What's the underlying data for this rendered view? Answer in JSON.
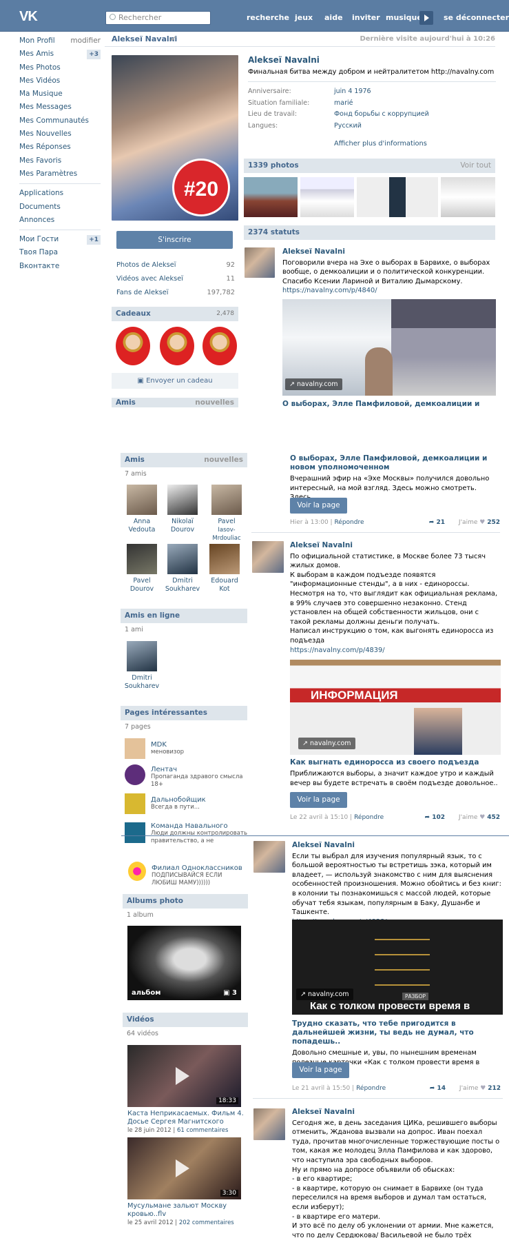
{
  "header": {
    "logo": "VK",
    "search_placeholder": "Rechercher",
    "nav": [
      "recherche",
      "jeux",
      "aide",
      "inviter",
      "musique",
      "se déconnecter"
    ]
  },
  "menu": {
    "items": [
      "Mon Profil",
      "Mes Amis",
      "Mes Photos",
      "Mes Vidéos",
      "Ma Musique",
      "Mes Messages",
      "Mes Communautés",
      "Mes Nouvelles",
      "Mes Réponses",
      "Mes Favoris",
      "Mes Paramètres"
    ],
    "edit": "modifier",
    "friends_badge": "+3",
    "extra": [
      "Applications",
      "Documents",
      "Annonces"
    ],
    "guests": [
      "Мои Гости",
      "Твоя Пара",
      "Вконтакте"
    ],
    "guests_badge": "+1"
  },
  "profile": {
    "name": "Alekseï Navalni",
    "last_visit": "Dernière visite aujourd'hui à 10:26",
    "status": "Финальная битва между добром и нейтралитетом http://navalny.com",
    "avatar_badge": "#20",
    "info": [
      {
        "label": "Anniversaire:",
        "value": "juin 4 1976"
      },
      {
        "label": "Situation familiale:",
        "value": "marié"
      },
      {
        "label": "Lieu de travail:",
        "value": "Фонд борьбы с коррупцией"
      },
      {
        "label": "Langues:",
        "value": "Русский"
      }
    ],
    "more_info": "Afficher plus d'informations",
    "subscribe": "S'inscrire",
    "counters": [
      {
        "label": "Photos de Alekseï",
        "value": "92"
      },
      {
        "label": "Vidéos avec Alekseï",
        "value": "11"
      },
      {
        "label": "Fans de Alekseï",
        "value": "197,782"
      }
    ]
  },
  "gifts": {
    "title": "Cadeaux",
    "count": "2,478",
    "send": "Envoyer un cadeau"
  },
  "photos": {
    "title": "1339 photos",
    "see_all": "Voir tout"
  },
  "statuses": {
    "title": "2374 statuts"
  },
  "friends": {
    "title": "Amis",
    "new": "nouvelles",
    "count": "7 amis",
    "list": [
      {
        "first": "Anna",
        "last": "Vedouta"
      },
      {
        "first": "Nikolaï",
        "last": "Dourov"
      },
      {
        "first": "Pavel",
        "last": "Iasov-Mrdouliac"
      },
      {
        "first": "Pavel",
        "last": "Dourov"
      },
      {
        "first": "Dmitri",
        "last": "Soukharev"
      },
      {
        "first": "Edouard",
        "last": "Kot"
      }
    ]
  },
  "online": {
    "title": "Amis en ligne",
    "count": "1 ami",
    "first": "Dmitri",
    "last": "Soukharev"
  },
  "pages": {
    "title": "Pages intéressantes",
    "count": "7 pages",
    "list": [
      {
        "name": "MDK",
        "desc": "меновизор"
      },
      {
        "name": "Лентач",
        "desc": "Пропаганда здравого смысла 18+"
      },
      {
        "name": "Дальнобойщик",
        "desc": "Всегда в пути..."
      },
      {
        "name": "Команда Навального",
        "desc": "Люди должны контролировать правительство, а не"
      },
      {
        "name": "Филиал Одноклассников",
        "desc": "ПОДПИСЫВАЙСЯ ЕСЛИ ЛЮБИШ МАМУ))))))"
      }
    ]
  },
  "albums": {
    "title": "Albums photo",
    "count": "1 album",
    "caption": "альбом",
    "photos": "3"
  },
  "videos": {
    "title": "Vidéos",
    "count": "64 vidéos",
    "list": [
      {
        "title": "Каста Неприкасаемых. Фильм 4. Досье Сергея Магнитского",
        "date": "le 28 juin 2012",
        "comments": "61 commentaires",
        "duration": "18:33"
      },
      {
        "title": "Мусульмане зальют Москву кровью..flv",
        "date": "le 25 avril 2012",
        "comments": "202 commentaires",
        "duration": "3:30"
      }
    ]
  },
  "posts": [
    {
      "author": "Alekseï Navalni",
      "text": "Поговорили вчера на Эхе о выборах в Барвихе, о выборах вообще, о демкоалиции и о политической конкуренции. Спасибо Ксении Лариной и Виталию Дымарскому.",
      "link": "https://navalny.com/p/4840/",
      "caption": "navalny.com",
      "title": "О выборах,  Элле Памфиловой, демкоалиции и новом уполномоченном",
      "desc": "Вчерашний эфир на «Эхе Москвы» получился довольно интересный, на мой взгляд. Здесь можно смотреть. Здесь..",
      "button": "Voir la page",
      "date": "Hier à 13:00",
      "reply": "Répondre",
      "shares": "21",
      "likes": "252",
      "like_label": "J'aime"
    },
    {
      "author": "Alekseï Navalni",
      "text": "По официальной статистике, в Москве более 73 тысяч жилых домов.\nК выборам в каждом подъезде появятся \"информационные стенды\", а в них - единороссы.\nНесмотря на то, что выглядит как официальная реклама, в 99% случаев это совершенно незаконно. Стенд установлен на общей собственности жильцов, они с такой рекламы должны деньги получать.\nНаписал инструкцию о том, как выгонять единоросса из подъезда",
      "link": "https://navalny.com/p/4839/",
      "caption": "navalny.com",
      "image_text": "ИНФОРМАЦИЯ",
      "title": "Как выгнать единоросса из своего подъезда",
      "desc": "Приближаются выборы, а значит каждое утро и каждый вечер вы будете встречать в своём подъезде довольное..",
      "button": "Voir la page",
      "date": "Le 22 avril à 15:10",
      "reply": "Répondre",
      "shares": "102",
      "likes": "452",
      "like_label": "J'aime"
    },
    {
      "author": "Alekseï Navalni",
      "text": "Если ты выбрал для изучения популярный язык, то с большой вероятностью ты встретишь зэка, который им владеет, — используй знакомство с ним для выяснения особенностей произношения. Можно обойтись и без книг: в колонии ты познакомишься с массой людей, которые обучат тебя языкам, популярным в Баку, Душанбе и Ташкенте.",
      "link": "https://navalny.com/p/4838/",
      "caption": "navalny.com",
      "image_text": "Как с толком провести время в",
      "image_tag": "РАЗБОР",
      "title": "Трудно сказать, что тебе пригодится в дальнейшей жизни, ты ведь не думал, что попадешь..",
      "desc": "Довольно смешные и, увы, по нынешним временам полезные карточки «Как с толком провести время в тюрьме?»...",
      "button": "Voir la page",
      "date": "Le 21 avril à 15:50",
      "reply": "Répondre",
      "shares": "14",
      "likes": "212",
      "like_label": "J'aime"
    },
    {
      "author": "Alekseï Navalni",
      "text": "Сегодня же, в день заседания ЦИКа, решившего выборы отменить, Жданова вызвали на допрос. Иван поехал туда, прочитав многочисленные торжествующие посты о том, какая же молодец Элла Памфилова и как здорово, что наступила эра свободных выборов.\nНу и прямо на допросе объявили об обысках:\n- в его квартире;\n- в квартире, которую он снимает в Барвихе (он туда переселился на время выборов и думал там остаться, если изберут);\n- в квартире его матери.\nИ это всё по делу об уклонении от армии. Мне кажется, что по делу Сердюкова/ Васильевой не было трёх обысков."
    }
  ]
}
